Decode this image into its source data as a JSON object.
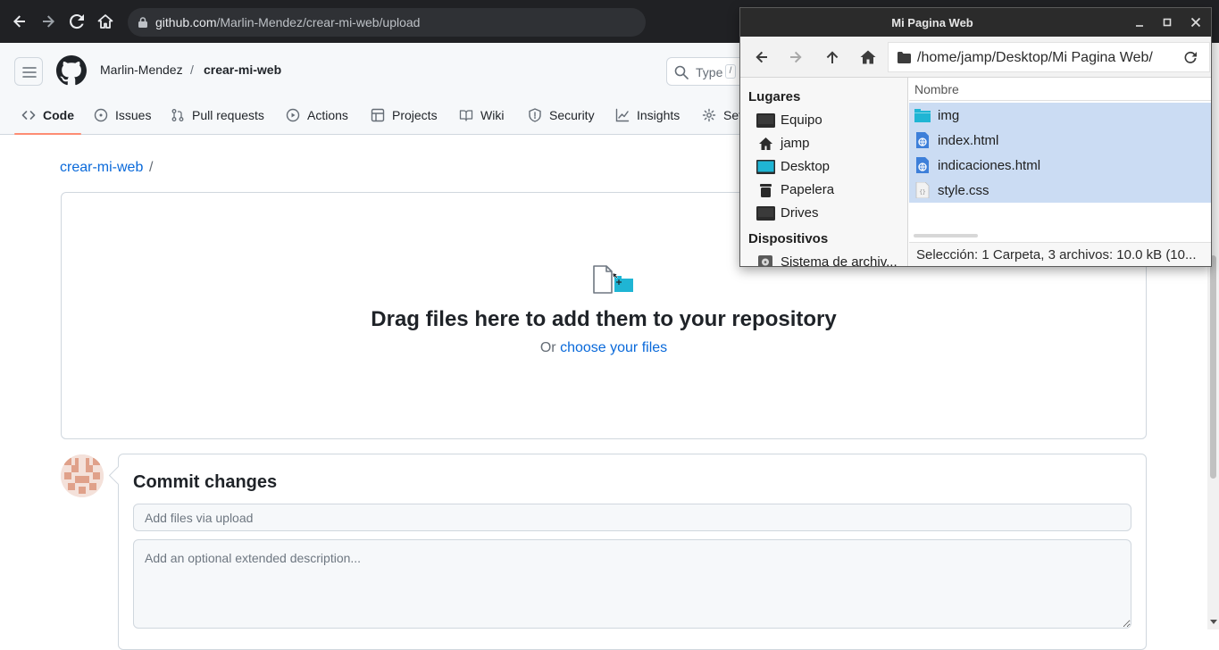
{
  "browser": {
    "url_host": "github.com",
    "url_path": "/Marlin-Mendez/crear-mi-web/upload",
    "icons": [
      "back-icon",
      "forward-icon",
      "reload-icon",
      "home-icon",
      "lock-icon"
    ]
  },
  "header": {
    "owner": "Marlin-Mendez",
    "separator": "/",
    "repo": "crear-mi-web",
    "search_placeholder": "Type",
    "search_kbd": "/"
  },
  "tabs": [
    {
      "label": "Code",
      "icon": "code-icon"
    },
    {
      "label": "Issues",
      "icon": "issue-icon"
    },
    {
      "label": "Pull requests",
      "icon": "pull-request-icon"
    },
    {
      "label": "Actions",
      "icon": "play-icon"
    },
    {
      "label": "Projects",
      "icon": "table-icon"
    },
    {
      "label": "Wiki",
      "icon": "book-icon"
    },
    {
      "label": "Security",
      "icon": "shield-icon"
    },
    {
      "label": "Insights",
      "icon": "graph-icon"
    },
    {
      "label": "Set",
      "icon": "gear-icon"
    }
  ],
  "main": {
    "path_repo": "crear-mi-web",
    "path_sep": "/",
    "dropzone_title": "Drag files here to add them to your repository",
    "dropzone_or": "Or",
    "dropzone_link": "choose your files",
    "commit_title": "Commit changes",
    "commit_placeholder": "Add files via upload",
    "description_placeholder": "Add an optional extended description..."
  },
  "file_manager": {
    "title": "Mi Pagina Web",
    "path": "/home/jamp/Desktop/Mi Pagina Web/",
    "sidebar_section_places": "Lugares",
    "places": [
      {
        "label": "Equipo",
        "icon": "computer-icon"
      },
      {
        "label": "jamp",
        "icon": "home-icon"
      },
      {
        "label": "Desktop",
        "icon": "desktop-icon"
      },
      {
        "label": "Papelera",
        "icon": "trash-icon"
      },
      {
        "label": "Drives",
        "icon": "drive-icon"
      }
    ],
    "sidebar_section_devices": "Dispositivos",
    "devices": [
      {
        "label": "Sistema de archiv...",
        "icon": "disk-icon"
      }
    ],
    "column_name": "Nombre",
    "files": [
      {
        "name": "img",
        "icon": "folder-icon"
      },
      {
        "name": "index.html",
        "icon": "html-file-icon"
      },
      {
        "name": "indicaciones.html",
        "icon": "html-file-icon"
      },
      {
        "name": "style.css",
        "icon": "css-file-icon"
      }
    ],
    "status": "Selección: 1 Carpeta, 3 archivos: 10.0 kB (10..."
  },
  "colors": {
    "link": "#0969da",
    "tab_underline": "#fd8c73",
    "selection": "#cbdcf3",
    "folder_teal": "#1fb5d4"
  }
}
